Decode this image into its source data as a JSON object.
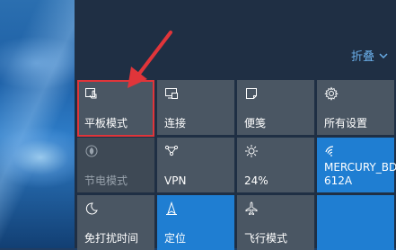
{
  "desktop": {},
  "action_center": {
    "collapse_label": "折叠",
    "tiles": [
      {
        "label": "平板模式",
        "icon": "tablet-mode-icon",
        "state": "normal",
        "highlighted": true
      },
      {
        "label": "连接",
        "icon": "connect-icon",
        "state": "normal"
      },
      {
        "label": "便笺",
        "icon": "note-icon",
        "state": "normal"
      },
      {
        "label": "所有设置",
        "icon": "gear-icon",
        "state": "normal"
      },
      {
        "label": "节电模式",
        "icon": "battery-saver-icon",
        "state": "disabled"
      },
      {
        "label": "VPN",
        "icon": "vpn-icon",
        "state": "normal"
      },
      {
        "label": "24%",
        "icon": "brightness-icon",
        "state": "normal"
      },
      {
        "label": "MERCURY_BD\n612A",
        "icon": "wifi-icon",
        "state": "active"
      },
      {
        "label": "免打扰时间",
        "icon": "moon-icon",
        "state": "normal"
      },
      {
        "label": "定位",
        "icon": "location-icon",
        "state": "active"
      },
      {
        "label": "飞行模式",
        "icon": "airplane-icon",
        "state": "normal"
      },
      {
        "label": "",
        "icon": "blank-icon",
        "state": "active"
      }
    ]
  },
  "colors": {
    "accent": "#1f7ed2",
    "tile": "#4a5663",
    "panel": "#1f2f44",
    "highlight": "#e0353a"
  }
}
